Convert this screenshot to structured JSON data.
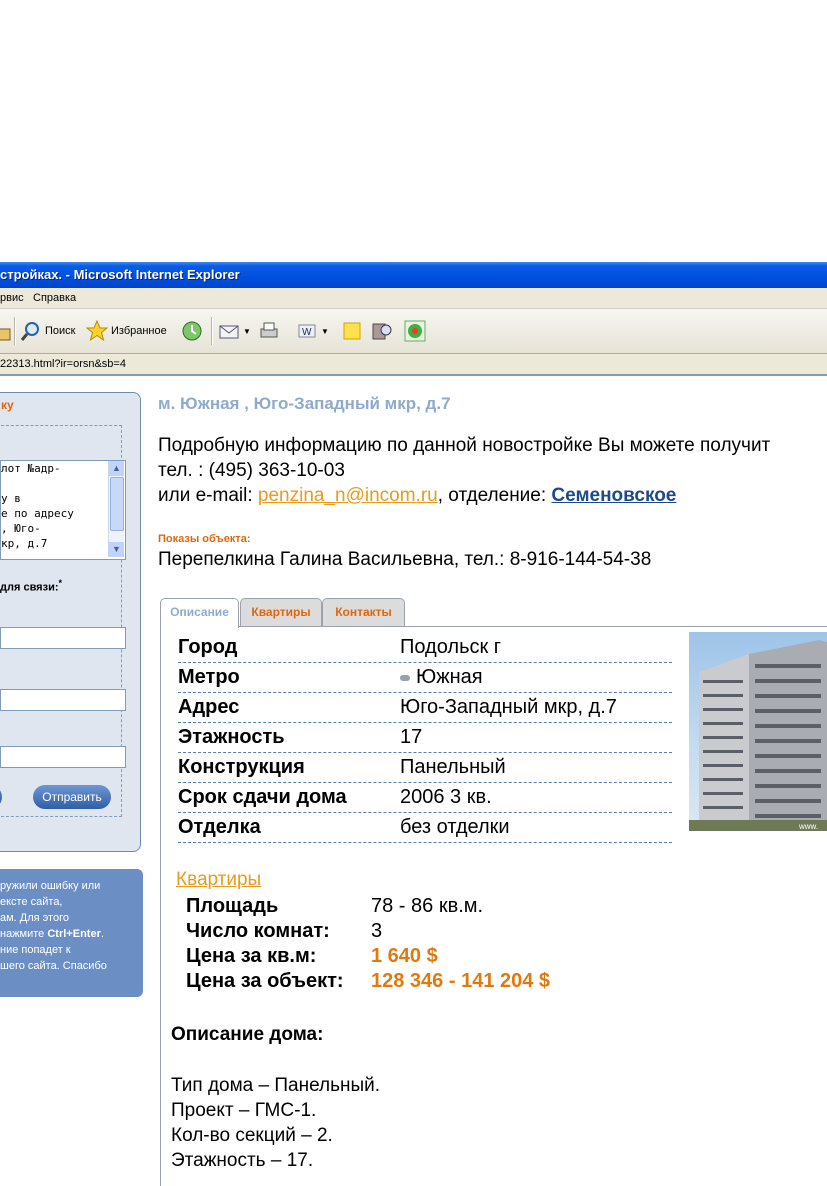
{
  "window": {
    "title": "стройках. - Microsoft Internet Explorer",
    "menu": [
      "рвис",
      "Справка"
    ],
    "address": "22313.html?ir=orsn&sb=4"
  },
  "toolbar": {
    "search_label": "Поиск",
    "favorites_label": "Избранное"
  },
  "left_panel": {
    "title": "ку",
    "message_text": "лот №адр-\n\nу в\nе по адресу\n, Юго-\nкр, д.7",
    "contact_label": "для связи:",
    "required_mark": "*",
    "send_label": "Отправить"
  },
  "error_notice": {
    "line1": "ружили ошибку или",
    "line2": "ексте сайта,",
    "line3": "ам. Для этого",
    "line4_prefix": "нажмите ",
    "line4_key": "Ctrl+Enter",
    "line4_suffix": ".",
    "line5": "ние попадет к",
    "line6": "шего сайта. Спасибо"
  },
  "main": {
    "address_title": "м. Южная , Юго-Западный мкр, д.7",
    "info_line1": "Подробную информацию по данной новостройке Вы можете получит",
    "info_phone": "тел. : (495) 363-10-03",
    "info_email_prefix": "или e-mail: ",
    "info_email": "penzina_n@incom.ru",
    "info_dept_prefix": ", отделение: ",
    "info_dept": "Семеновское",
    "shows_label": "Показы объекта:",
    "shows_contact": "Перепелкина Галина Васильевна,  тел.: 8-916-144-54-38"
  },
  "tabs": [
    {
      "label": "Описание",
      "active": true
    },
    {
      "label": "Квартиры",
      "active": false
    },
    {
      "label": "Контакты",
      "active": false
    }
  ],
  "properties": [
    {
      "key": "Город",
      "value": "Подольск г"
    },
    {
      "key": "Метро",
      "value": "Южная"
    },
    {
      "key": "Адрес",
      "value": "Юго-Западный мкр, д.7"
    },
    {
      "key": "Этажность",
      "value": "17"
    },
    {
      "key": "Конструкция",
      "value": "Панельный"
    },
    {
      "key": "Срок сдачи дома",
      "value": "2006 3 кв."
    },
    {
      "key": "Отделка",
      "value": "без отделки"
    }
  ],
  "photo_watermark": "www.",
  "flats": {
    "title": "Квартиры",
    "rows": [
      {
        "key": "Площадь",
        "value": "78 - 86 кв.м."
      },
      {
        "key": "Число комнат:",
        "value": "3"
      },
      {
        "key": "Цена за кв.м:",
        "value": "1 640  $"
      },
      {
        "key": "Цена за объект:",
        "value": "128 346 - 141 204  $"
      }
    ]
  },
  "description": {
    "title": "Описание дома:",
    "lines": [
      "Тип дома – Панельный.",
      "Проект – ГМС-1.",
      "Кол-во секций – 2.",
      "Этажность – 17."
    ]
  }
}
